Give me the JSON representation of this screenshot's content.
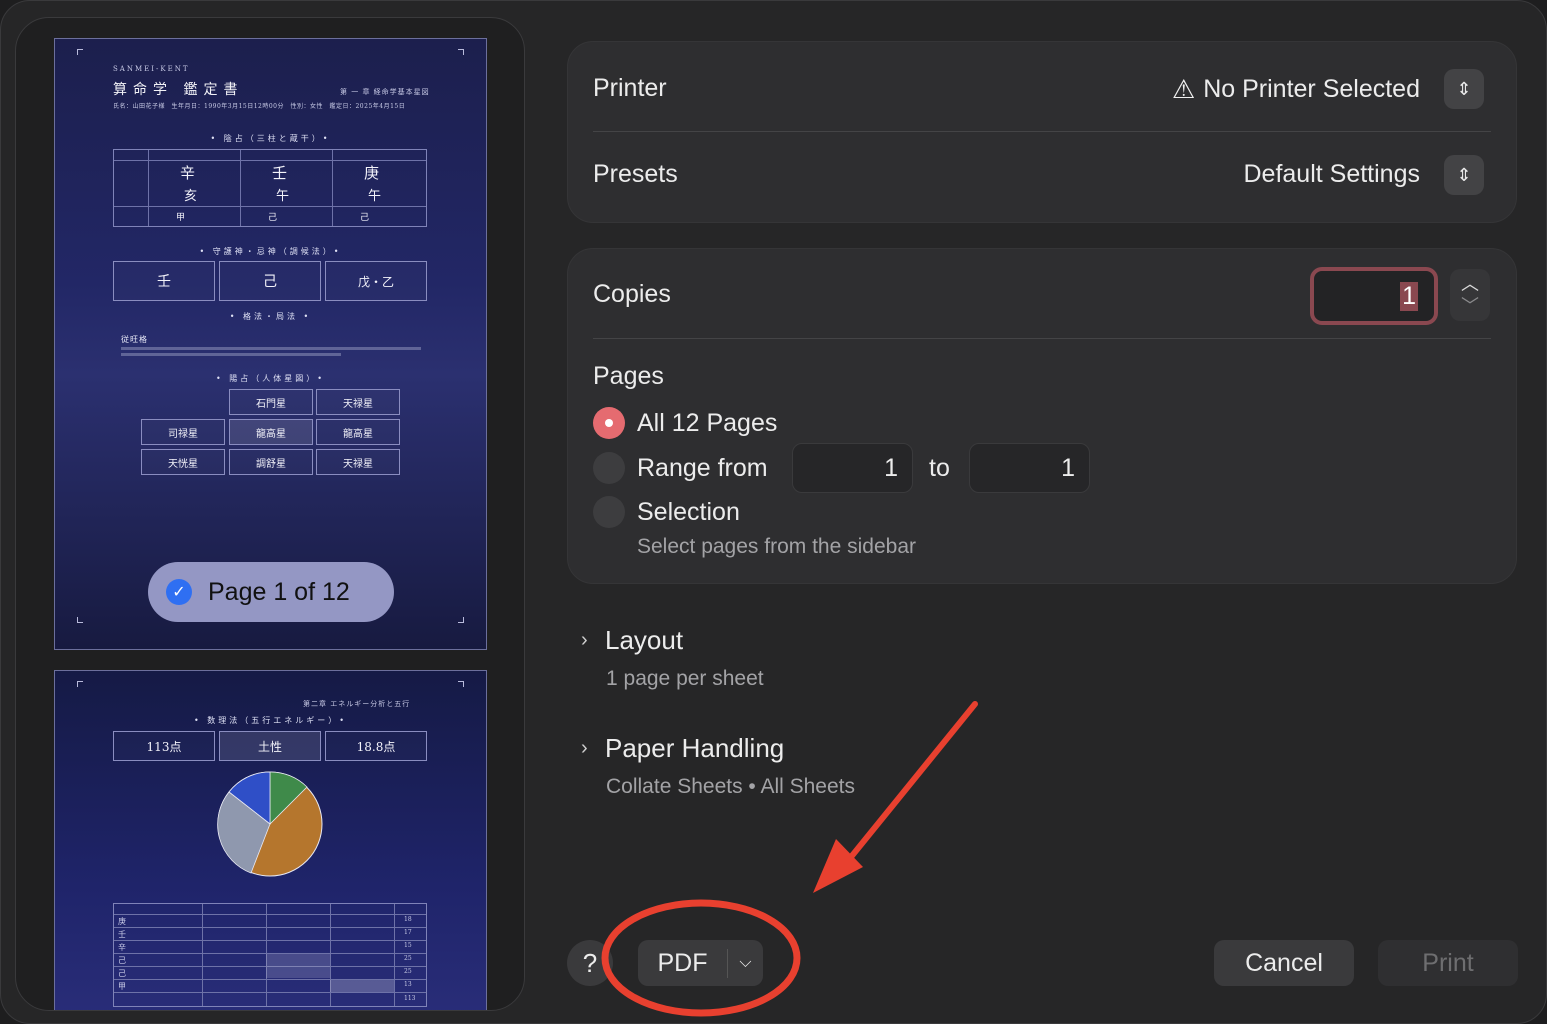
{
  "sidebar": {
    "page_badge": "Page 1 of 12",
    "thumb1": {
      "brand": "SANMEI-KENT",
      "title": "算命学 鑑定書",
      "header_right": "第 一 章 経命学基本星図",
      "info_line": "氏名：山田花子様　生年月日：1990年3月15日12時00分　性別：女性　鑑定日：2025年4月15日",
      "section1": "• 陰占（三柱と蔵干）•",
      "pillars": [
        {
          "top": "辛",
          "bottom": "亥",
          "foot": "甲"
        },
        {
          "top": "壬",
          "bottom": "午",
          "foot": "己"
        },
        {
          "top": "庚",
          "bottom": "午",
          "foot": "己"
        }
      ],
      "section2": "• 守護神・忌神（調候法）•",
      "guardians": [
        "壬",
        "己",
        "戊・乙"
      ],
      "section3": "• 格法・局法 •",
      "kakuho": "従旺格",
      "section4": "• 陽占（人体星図）•",
      "stars": [
        "石門星",
        "天禄星",
        "司禄星",
        "龍高星",
        "龍高星",
        "天恍星",
        "調舒星",
        "天禄星"
      ]
    },
    "thumb2": {
      "header_right": "第二章 エネルギー分析と五行",
      "section1": "• 数理法（五行エネルギー）•",
      "energy": [
        "113点",
        "土性",
        "18.8点"
      ],
      "table_rows": [
        {
          "k": "庚",
          "v": "18"
        },
        {
          "k": "壬",
          "v": "17"
        },
        {
          "k": "辛",
          "v": "15"
        },
        {
          "k": "己",
          "v": "25"
        },
        {
          "k": "己",
          "v": "25"
        },
        {
          "k": "甲",
          "v": "13"
        }
      ],
      "total": "113"
    }
  },
  "printer": {
    "label": "Printer",
    "value": "No Printer Selected",
    "warning_icon": "warning-triangle-icon"
  },
  "presets": {
    "label": "Presets",
    "value": "Default Settings"
  },
  "copies": {
    "label": "Copies",
    "value": "1"
  },
  "pages": {
    "label": "Pages",
    "all_label": "All 12 Pages",
    "range_label": "Range from",
    "range_from": "1",
    "to_label": "to",
    "range_to": "1",
    "selection_label": "Selection",
    "selection_hint": "Select pages from the sidebar"
  },
  "layout": {
    "title": "Layout",
    "subtitle": "1 page per sheet"
  },
  "paper_handling": {
    "title": "Paper Handling",
    "subtitle": "Collate Sheets • All Sheets"
  },
  "footer": {
    "help": "?",
    "pdf": "PDF",
    "cancel": "Cancel",
    "print": "Print"
  },
  "colors": {
    "accent_radio": "#e56b70",
    "annotation_red": "#e8402f",
    "checkmark_blue": "#2f6ff2"
  }
}
